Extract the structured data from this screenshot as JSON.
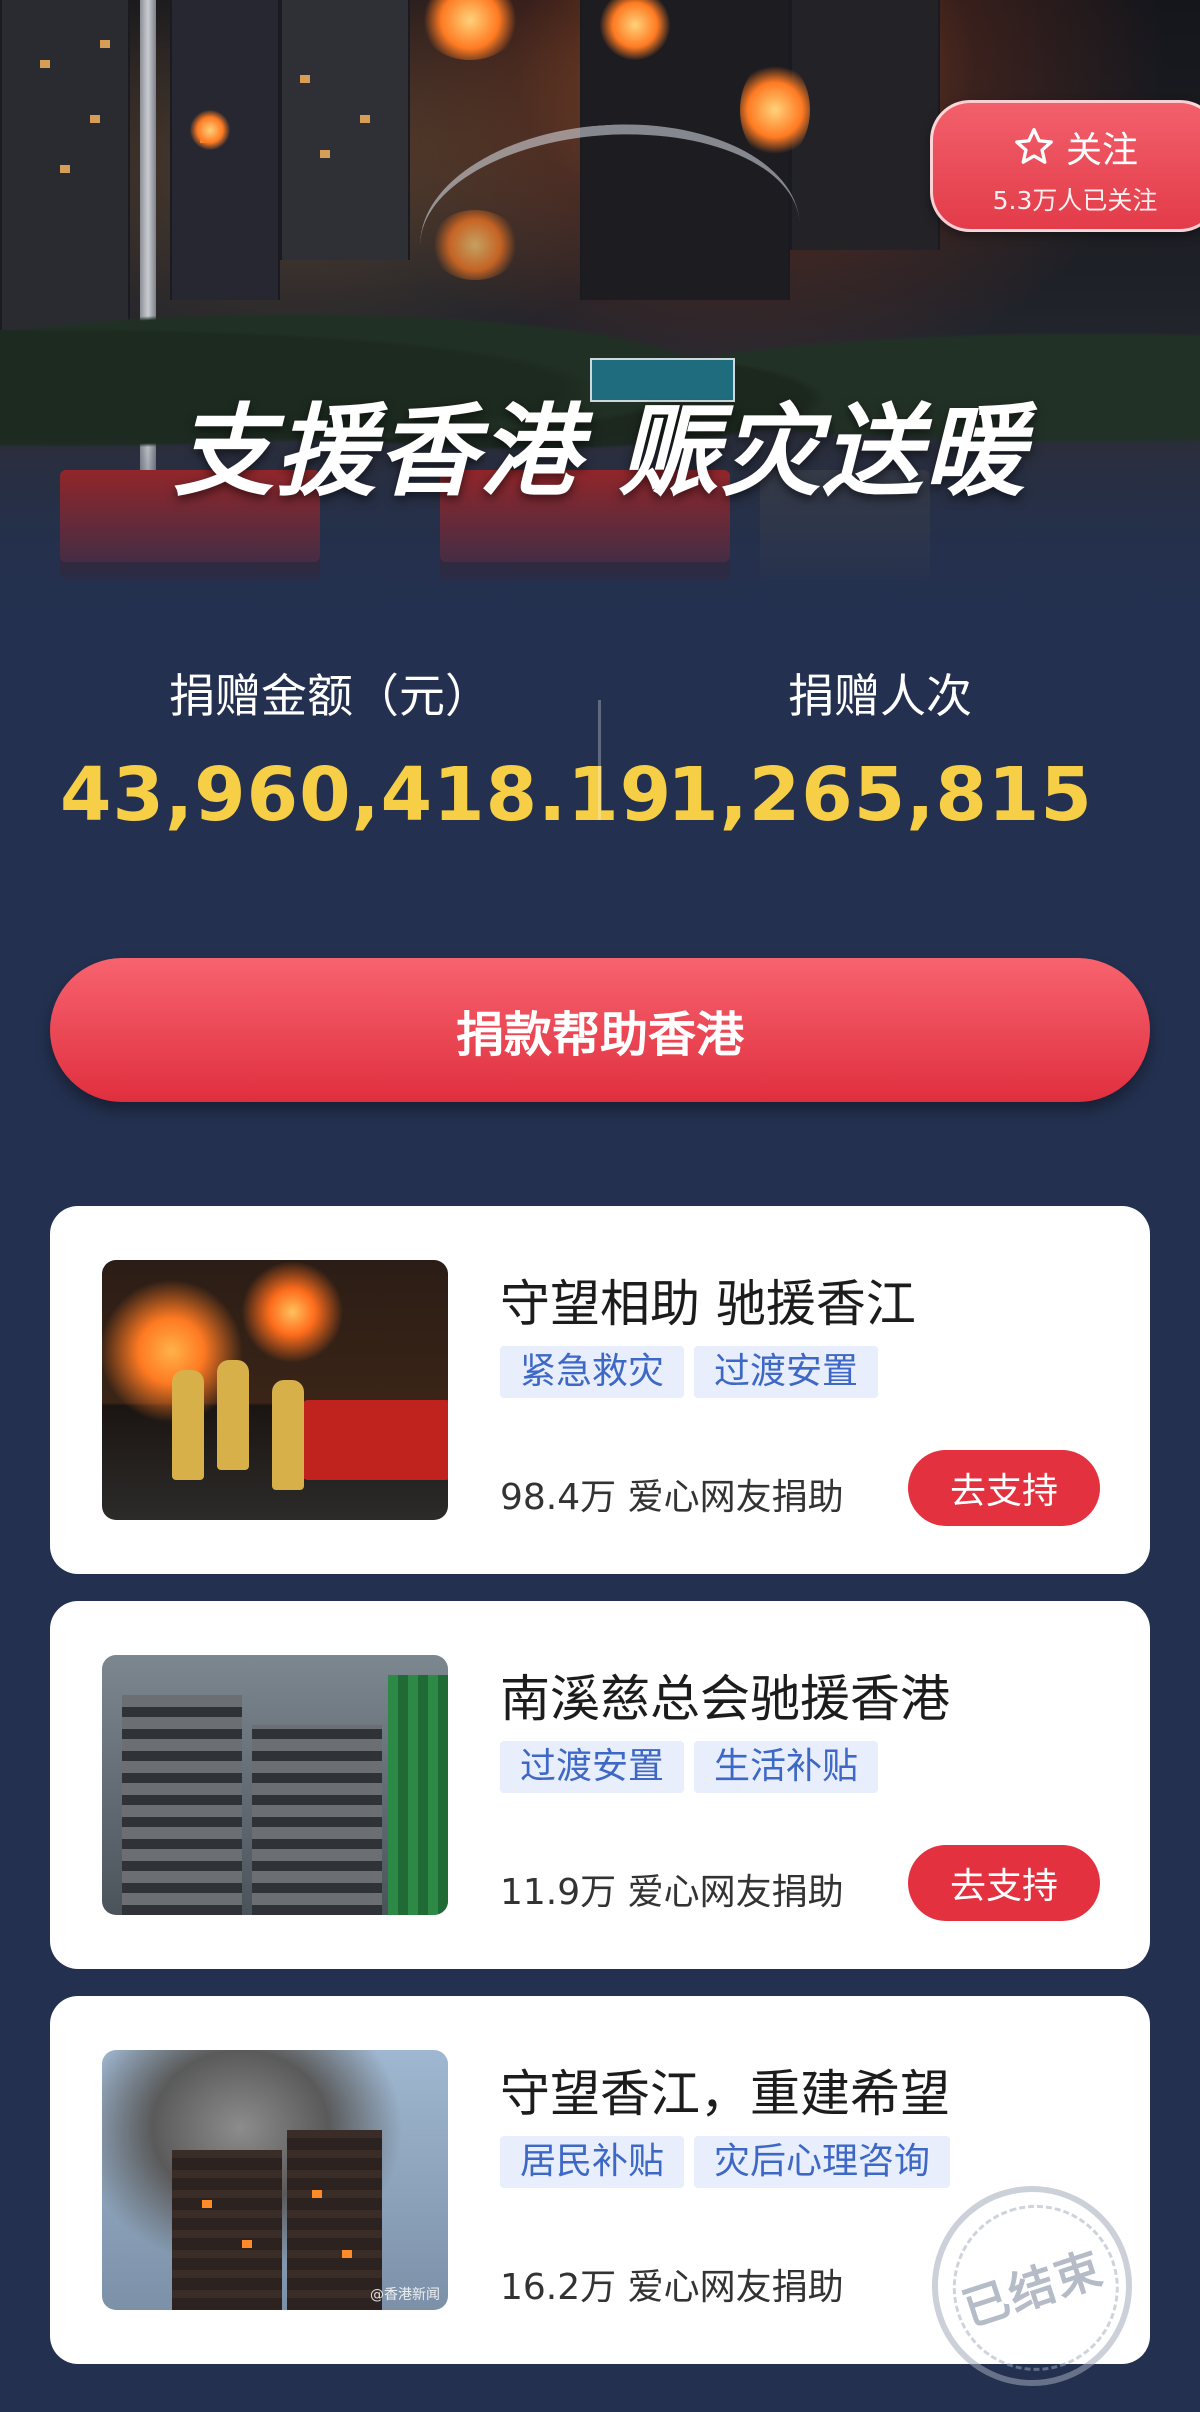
{
  "hero": {
    "title": "支援香港 赈灾送暖",
    "follow_label": "关注",
    "follow_count": "5.3万人已关注",
    "icon": "star-icon"
  },
  "stats": {
    "amount_label": "捐赠金额（元）",
    "amount_value": "43,960,418.19",
    "donors_label": "捐赠人次",
    "donors_value": "1,265,815"
  },
  "donate_button": "捐款帮助香港",
  "colors": {
    "background": "#23304f",
    "accent_red": "#e3313f",
    "stat_yellow": "#f7cf47",
    "tag_blue": "#3e68c6",
    "tag_bg": "#e8eefb"
  },
  "projects": [
    {
      "title": "守望相助 驰援香江",
      "tags": [
        "紧急救灾",
        "过渡安置"
      ],
      "supporters": "98.4万 爱心网友捐助",
      "action": "去支持"
    },
    {
      "title": "南溪慈总会驰援香港",
      "tags": [
        "过渡安置",
        "生活补贴"
      ],
      "supporters": "11.9万 爱心网友捐助",
      "action": "去支持"
    },
    {
      "title": "守望香江，重建希望",
      "tags": [
        "居民补贴",
        "灾后心理咨询"
      ],
      "supporters": "16.2万 爱心网友捐助",
      "status": "已结束",
      "watermark": "@香港新闻"
    }
  ]
}
